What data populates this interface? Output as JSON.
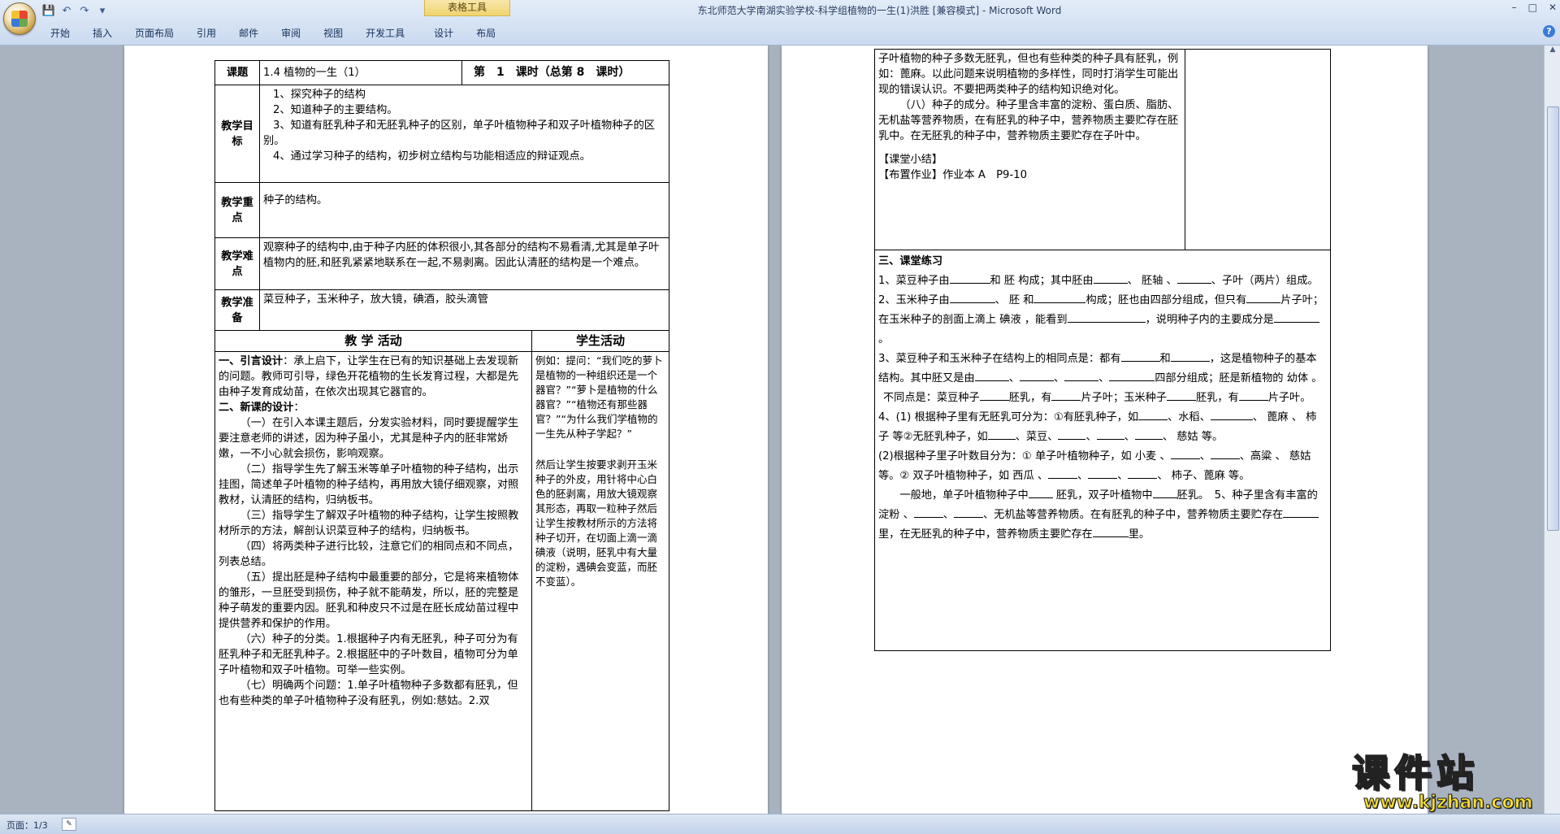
{
  "window": {
    "title": "东北师范大学南湖实验学校-科学组植物的一生(1)洪胜 [兼容模式] - Microsoft Word",
    "context_tab_header": "表格工具",
    "controls": {
      "minimize": "–",
      "maximize": "□",
      "close": "✕"
    }
  },
  "qat": {
    "save": "💾",
    "undo": "↶",
    "redo": "↷",
    "more": "▾"
  },
  "ribbon": {
    "tabs": [
      "开始",
      "插入",
      "页面布局",
      "引用",
      "邮件",
      "审阅",
      "视图",
      "开发工具",
      "设计",
      "布局"
    ]
  },
  "page1": {
    "topic_label": "课题",
    "topic_value": "1.4 植物的一生（1）",
    "period": "第　1　课时（总第 8　课时）",
    "goals_label": "教学目标",
    "goals": [
      "1、探究种子的结构",
      "2、知道种子的主要结构。",
      "3、知道有胚乳种子和无胚乳种子的区别，单子叶植物种子和双子叶植物种子的区别。",
      "4、通过学习种子的结构，初步树立结构与功能相适应的辩证观点。"
    ],
    "key_label": "教学重点",
    "key_value": "种子的结构。",
    "diff_label": "教学难点",
    "diff_value": "观察种子的结构中,由于种子内胚的体积很小,其各部分的结构不易看清,尤其是单子叶植物内的胚,和胚乳紧紧地联系在一起,不易剥离。因此认清胚的结构是一个难点。",
    "prep_label": "教学准备",
    "prep_value": "菜豆种子，玉米种子，放大镜，碘酒，胶头滴管",
    "teach_header": "教 学 活动",
    "student_header": "学生活动",
    "intro_title": "一、引言设计",
    "intro_text": "：承上启下，让学生在已有的知识基础上去发现新的问题。教师可引导，绿色开花植物的生长发育过程，大都是先由种子发育成幼苗，在依次出现其它器官的。",
    "new_title": "二、新课的设计",
    "new_colon": "：",
    "steps": [
      "（一）在引入本课主题后，分发实验材料，同时要提醒学生要注意老师的讲述，因为种子虽小，尤其是种子内的胚非常娇嫩，一不小心就会损伤，影响观察。",
      "（二）指导学生先了解玉米等单子叶植物的种子结构，出示挂图，简述单子叶植物的种子结构，再用放大镜仔细观察，对照教材，认清胚的结构，归纳板书。",
      "（三）指导学生了解双子叶植物的种子结构，让学生按照教材所示的方法，解剖认识菜豆种子的结构，归纳板书。",
      "（四）将两类种子进行比较，注意它们的相同点和不同点，列表总结。",
      "（五）提出胚是种子结构中最重要的部分，它是将来植物体的雏形，一旦胚受到损伤，种子就不能萌发，所以，胚的完整是种子萌发的重要内因。胚乳和种皮只不过是在胚长成幼苗过程中提供营养和保护的作用。",
      "（六）种子的分类。1.根据种子内有无胚乳，种子可分为有胚乳种子和无胚乳种子。2.根据胚中的子叶数目，植物可分为单子叶植物和双子叶植物。可举一些实例。",
      "（七）明确两个问题：1.单子叶植物种子多数都有胚乳，但也有些种类的单子叶植物种子没有胚乳，例如:慈姑。2.双"
    ],
    "student_text1": "例如：提问：“我们吃的萝卜是植物的一种组织还是一个器官？”“萝卜是植物的什么器官？”“植物还有那些器官？”“为什么我们学植物的一生先从种子学起？”",
    "student_text2": "然后让学生按要求剥开玉米种子的外皮，用针将中心白色的胚剥离，用放大镜观察其形态，再取一粒种子然后让学生按教材所示的方法将种子切开，在切面上滴一滴碘液（说明，胚乳中有大量的淀粉，遇碘会变蓝，而胚不变蓝）。"
  },
  "page2": {
    "cont_text": "子叶植物的种子多数无胚乳，但也有些种类的种子具有胚乳，例如：蓖麻。以此问题来说明植物的多样性，同时打消学生可能出现的错误认识。不要把两类种子的结构知识绝对化。",
    "step8": "（八）种子的成分。种子里含丰富的淀粉、蛋白质、脂肪、无机盐等营养物质，在有胚乳的种子中，营养物质主要贮存在胚乳中。在无胚乳的种子中，营养物质主要贮存在子叶中。",
    "summary": "【课堂小结】",
    "homework_label": "【布置作业】",
    "homework_value": "作业本 A　P9-10",
    "practice_title": "三、课堂练习",
    "q1": [
      "1、菜豆种子由",
      "和 胚 构成；其中胚由",
      "、 胚轴 、",
      "、子叶（两片）组成。"
    ],
    "q2": [
      "2、玉米种子由",
      "、 胚 和",
      "构成；胚也由四部分组成，但只有",
      "片子叶；在玉米种子的剖面上滴上 碘液 ，能看到",
      "，说明种子内的主要成分是",
      "。"
    ],
    "q3": [
      "3、菜豆种子和玉米种子在结构上的相同点是：都有",
      "和",
      "，这是植物种子的基本结构。其中胚又是由",
      "、",
      "、",
      "、",
      "四部分组成；胚是新植物的 幼体 。"
    ],
    "q3b": [
      "不同点是：菜豆种子",
      "胚乳，有",
      "片子叶；玉米种子",
      "胚乳，有",
      "片子叶。"
    ],
    "q4a": [
      "4、(1) 根据种子里有无胚乳可分为：①有胚乳种子，如",
      "、水稻、",
      "、 蓖麻 、 柿子 等②无胚乳种子，如",
      "、菜豆、",
      "、",
      "、",
      "、 慈姑 等。"
    ],
    "q4b": [
      "(2)根据种子里子叶数目分为：① 单子叶植物种子，如 小麦 、",
      "、",
      "、高粱 、 慈姑 等。② 双子叶植物种子，如 西瓜 、",
      "、",
      "、",
      "、 柿子、蓖麻 等。"
    ],
    "q4c": [
      "一般地，单子叶植物种子中",
      " 胚乳，双子叶植物中",
      "胚乳。　5、种子里含有丰富的 淀粉 、",
      "、",
      "、无机盐等营养物质。在有胚乳的种子中，营养物质主要贮存在",
      "里，在无胚乳的种子中，营养物质主要贮存在",
      "里。"
    ]
  },
  "statusbar": {
    "page": "页面：1/3"
  },
  "watermark": {
    "title": "课件站",
    "url": "www.kjzhan.com"
  }
}
